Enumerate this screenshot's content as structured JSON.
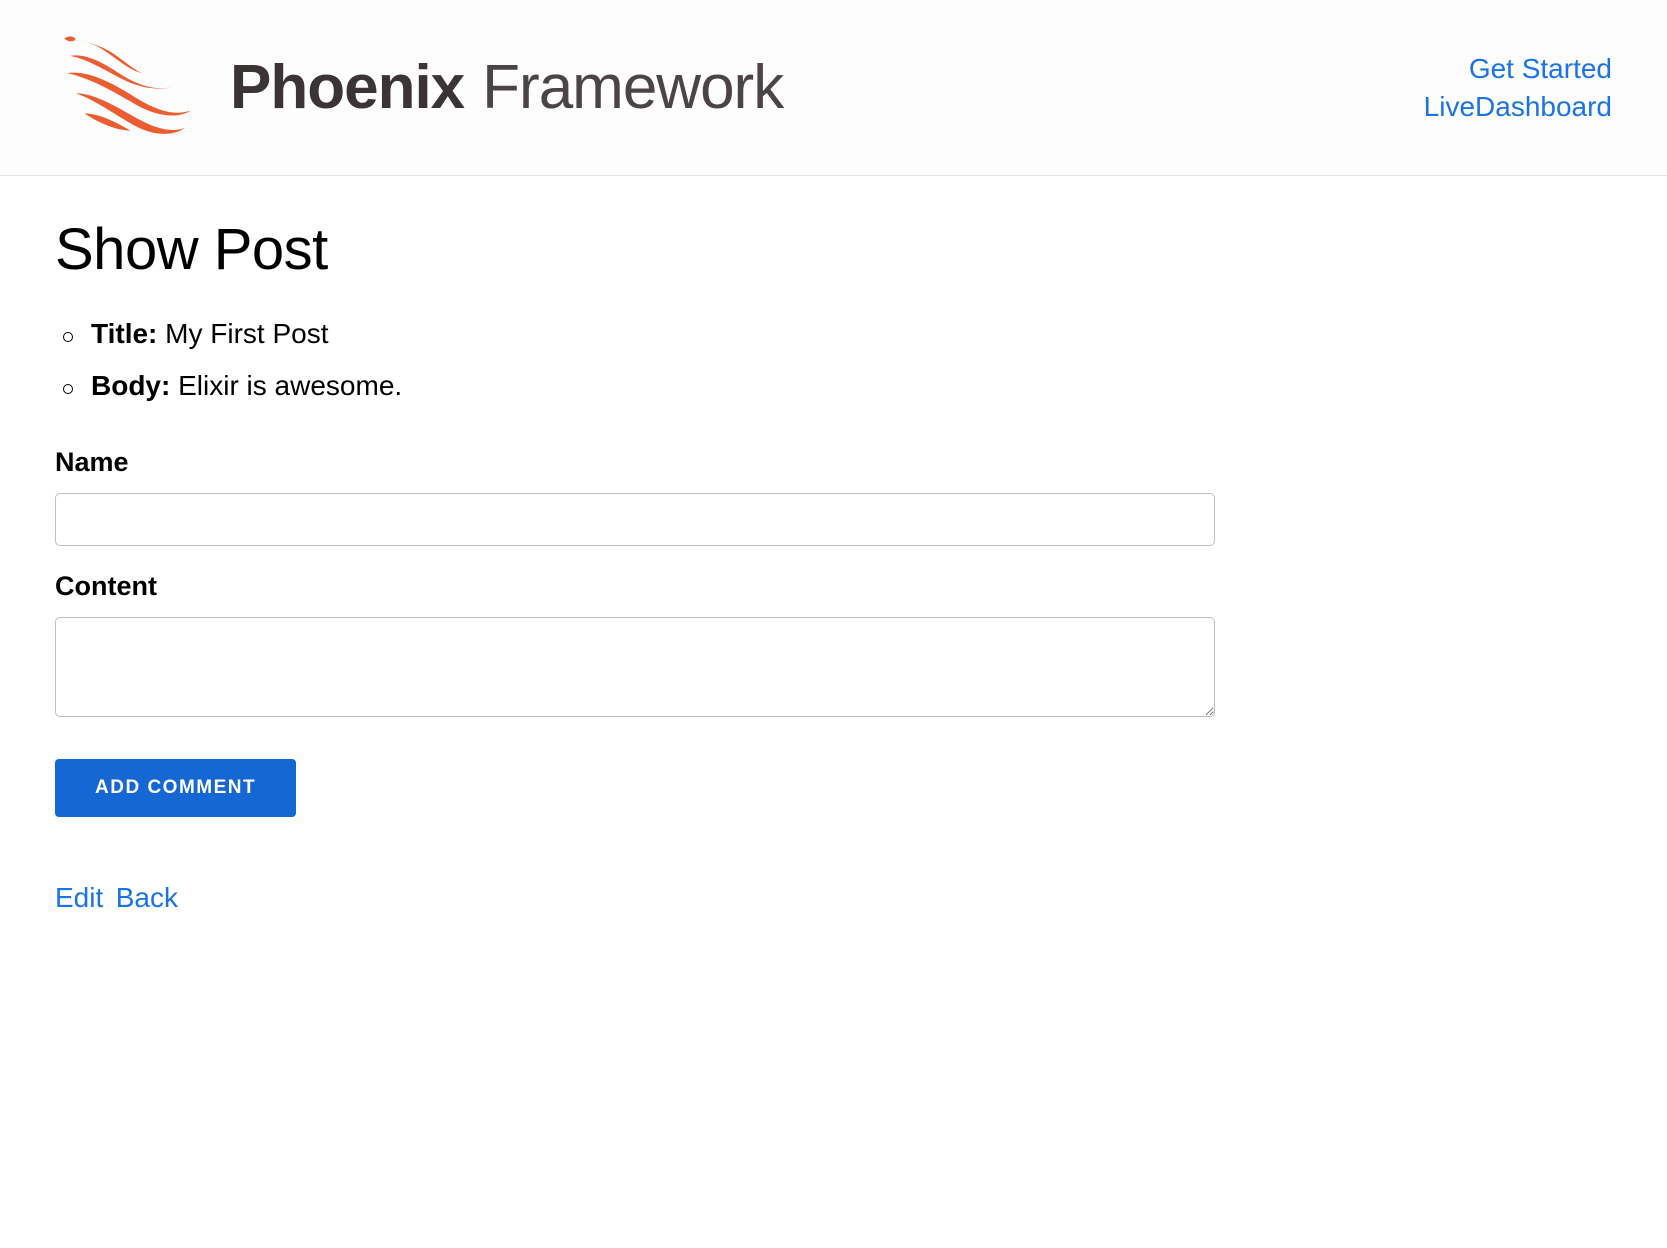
{
  "header": {
    "logo_bold": "Phoenix",
    "logo_light": "Framework",
    "nav": {
      "get_started": "Get Started",
      "live_dashboard": "LiveDashboard"
    }
  },
  "main": {
    "page_title": "Show Post",
    "post": {
      "title_label": "Title:",
      "title_value": "My First Post",
      "body_label": "Body:",
      "body_value": "Elixir is awesome."
    },
    "form": {
      "name_label": "Name",
      "name_value": "",
      "content_label": "Content",
      "content_value": "",
      "submit_label": "ADD COMMENT"
    },
    "links": {
      "edit": "Edit",
      "back": "Back"
    }
  }
}
